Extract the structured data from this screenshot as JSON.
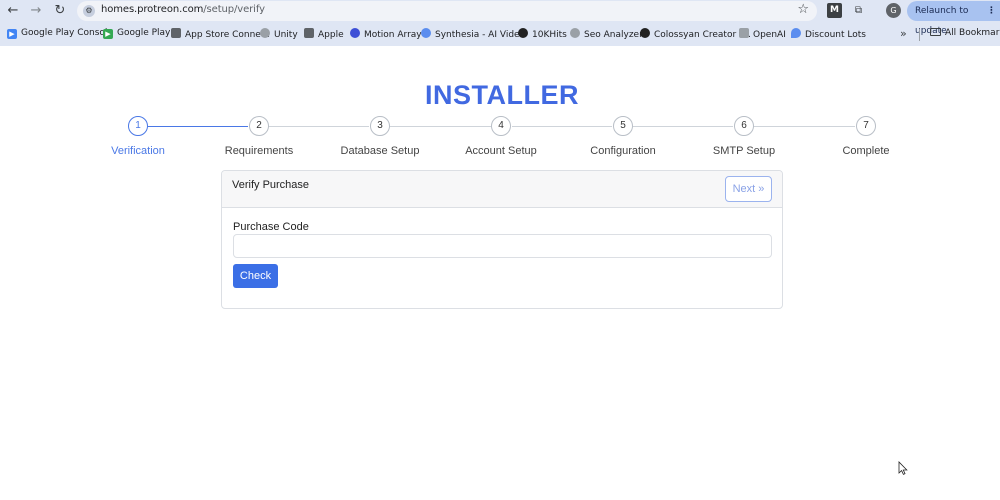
{
  "browser": {
    "url_host": "homes.protreon.com",
    "url_path": "/setup/verify",
    "relaunch_label": "Relaunch to update",
    "bookmarks": [
      {
        "label": "Google Play Console",
        "icon": "google-play-console-icon",
        "color": "#4285f4"
      },
      {
        "label": "Google Play",
        "icon": "google-play-icon",
        "color": "#34a853"
      },
      {
        "label": "App Store Connect",
        "icon": "apple-icon",
        "color": "#5f6368"
      },
      {
        "label": "Unity",
        "icon": "unity-icon",
        "color": "#9aa0a6"
      },
      {
        "label": "Apple",
        "icon": "apple-icon",
        "color": "#5f6368"
      },
      {
        "label": "Motion Array",
        "icon": "motion-array-icon",
        "color": "#3d4fd6"
      },
      {
        "label": "Synthesia - AI Video",
        "icon": "synthesia-icon",
        "color": "#5b8def"
      },
      {
        "label": "10KHits",
        "icon": "10khits-icon",
        "color": "#222222"
      },
      {
        "label": "Seo Analyzer",
        "icon": "seo-analyzer-icon",
        "color": "#9aa0a6"
      },
      {
        "label": "Colossyan Creator -...",
        "icon": "colossyan-icon",
        "color": "#222222"
      },
      {
        "label": "OpenAI",
        "icon": "openai-icon",
        "color": "#9aa0a6"
      },
      {
        "label": "Discount Lots",
        "icon": "location-pin-icon",
        "color": "#5b8def"
      }
    ],
    "more_label": "»",
    "all_bookmarks_label": "All Bookmarks"
  },
  "installer": {
    "title": "INSTALLER",
    "steps": [
      {
        "number": "1",
        "label": "Verification",
        "active": true
      },
      {
        "number": "2",
        "label": "Requirements",
        "active": false
      },
      {
        "number": "3",
        "label": "Database Setup",
        "active": false
      },
      {
        "number": "4",
        "label": "Account Setup",
        "active": false
      },
      {
        "number": "5",
        "label": "Configuration",
        "active": false
      },
      {
        "number": "6",
        "label": "SMTP Setup",
        "active": false
      },
      {
        "number": "7",
        "label": "Complete",
        "active": false
      }
    ],
    "card": {
      "title": "Verify Purchase",
      "next_label": "Next »",
      "field_label": "Purchase Code",
      "field_value": "",
      "field_placeholder": "",
      "check_label": "Check"
    }
  },
  "colors": {
    "accent": "#4169e1",
    "button": "#3b6fe6",
    "chrome": "#dfe6f4"
  }
}
